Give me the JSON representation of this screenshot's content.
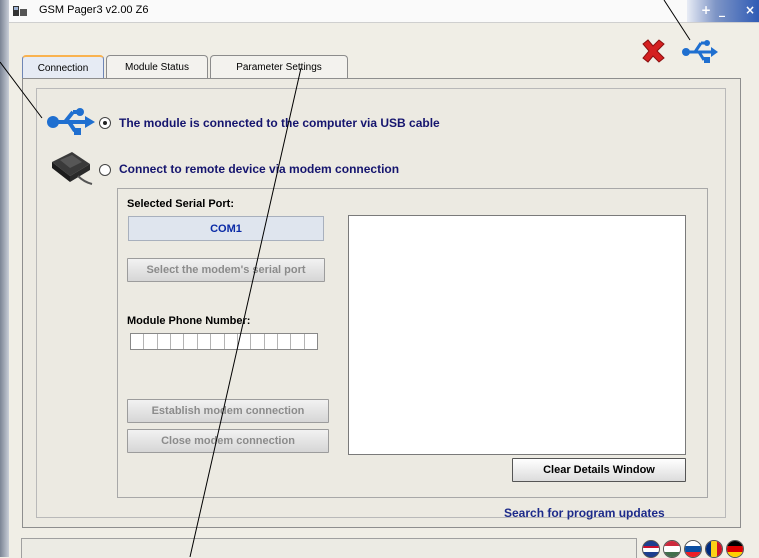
{
  "window": {
    "title": "GSM Pager3  v2.00 Z6",
    "controls": [
      "+",
      "_",
      "×"
    ]
  },
  "tabs": [
    {
      "label": "Connection",
      "active": true
    },
    {
      "label": "Module Status",
      "active": false
    },
    {
      "label": "Parameter Settings",
      "active": false
    }
  ],
  "connection": {
    "usb_option_label": "The module is connected to the computer via USB cable",
    "modem_option_label": "Connect to remote device via modem connection",
    "selected_option": "usb"
  },
  "modem": {
    "serial_port_label": "Selected Serial Port:",
    "serial_port_value": "COM1",
    "select_port_button": "Select the modem's serial port",
    "phone_label": "Module Phone Number:",
    "phone_digits": [
      "",
      "",
      "",
      "",
      "",
      "",
      "",
      "",
      "",
      "",
      "",
      "",
      "",
      ""
    ],
    "establish_button": "Establish modem connection",
    "close_button": "Close modem connection",
    "clear_details_button": "Clear Details Window"
  },
  "updates_link": "Search for program updates",
  "icons": {
    "app": "gsm-pager-app-icon",
    "disconnect": "red-x-icon",
    "usb": "usb-icon",
    "modem": "modem-device-icon"
  },
  "language_flags": [
    "en",
    "hu",
    "sk",
    "ro",
    "de"
  ],
  "colors": {
    "accent_text": "#15156e",
    "tab_highlight": "#f9b24f",
    "disconnect_red": "#d42020",
    "usb_blue": "#1f6fd0"
  }
}
